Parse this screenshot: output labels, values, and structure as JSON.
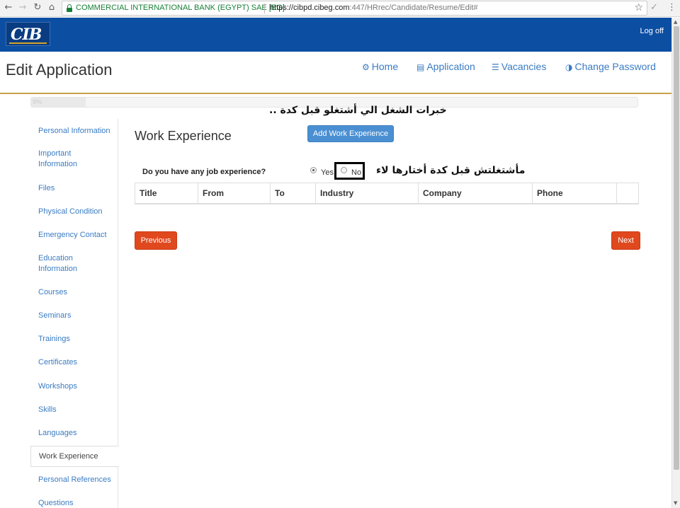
{
  "browser": {
    "back_icon": "←",
    "forward_icon": "→",
    "reload_icon": "↻",
    "home_icon": "⌂",
    "ev_name": "COMMERCIAL INTERNATIONAL BANK (EGYPT) SAE [EG]",
    "url_host": "https://cibpd.cibeg.com",
    "url_path": ":447/HRrec/Candidate/Resume/Edit#",
    "star_icon": "☆",
    "check_icon": "✓",
    "menu_icon": "⋮"
  },
  "header": {
    "logo_text": "CIB",
    "logoff": "Log off",
    "brand_color": "#0c4ea2"
  },
  "title_bar": {
    "page_title": "Edit Application",
    "nav": [
      {
        "icon": "⚙",
        "label": "Home"
      },
      {
        "icon": "▤",
        "label": "Application"
      },
      {
        "icon": "☰",
        "label": "Vacancies"
      },
      {
        "icon": "◑",
        "label": "Change Password"
      }
    ]
  },
  "progress": {
    "text": "9%",
    "value": 0.09
  },
  "annotations": {
    "top": "خبرات الشغل الي أشتغلو قبل كدة ..",
    "side": "مأشتغلتش قبل كدة أختارها لاء"
  },
  "sidebar": {
    "items": [
      "Personal Information",
      "Important Information",
      "Files",
      "Physical Condition",
      "Emergency Contact",
      "Education Information",
      "Courses",
      "Seminars",
      "Trainings",
      "Certificates",
      "Workshops",
      "Skills",
      "Languages",
      "Work Experience",
      "Personal References",
      "Questions"
    ],
    "active": "Work Experience"
  },
  "main": {
    "section_title": "Work Experience",
    "add_button": "Add Work Experience",
    "question": "Do you have any job experience?",
    "option_yes": "Yes",
    "option_no": "No",
    "selected": "Yes",
    "columns": [
      "Title",
      "From",
      "To",
      "Industry",
      "Company",
      "Phone",
      ""
    ],
    "prev_button": "Previous",
    "next_button": "Next"
  }
}
